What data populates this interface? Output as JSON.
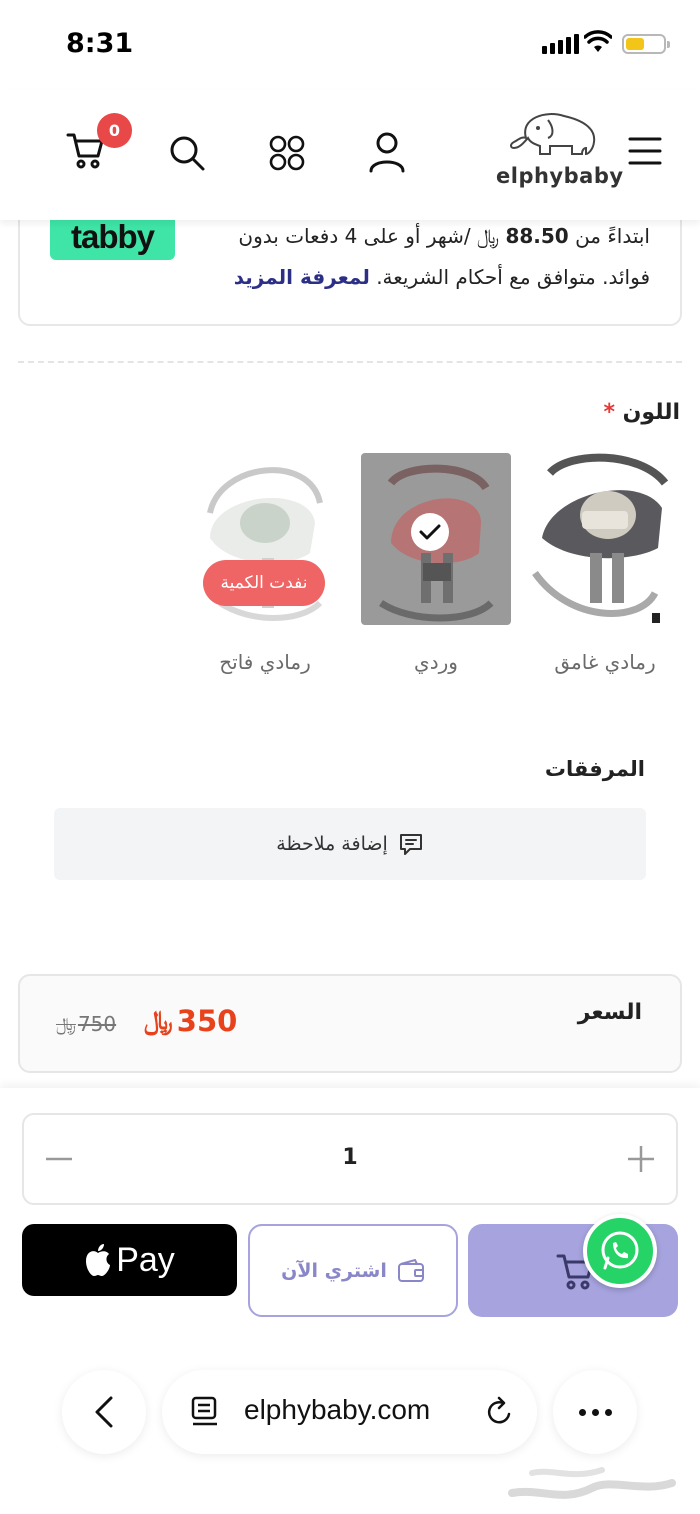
{
  "status_bar": {
    "time": "8:31"
  },
  "header": {
    "cart_count": "0",
    "logo_text": "elphybaby"
  },
  "tabby": {
    "logo": "tabby",
    "line1_prefix": "ابتداءً من ",
    "amount": "88.50",
    "line1_suffix": " /شهر أو على 4 دفعات بدون",
    "line2": "فوائد. متوافق مع أحكام الشريعة. ",
    "learn_more": "لمعرفة المزيد"
  },
  "color_section": {
    "label": "اللون",
    "required_mark": "*",
    "options": [
      {
        "name": "رمادي غامق",
        "selected": false,
        "out_of_stock": false
      },
      {
        "name": "وردي",
        "selected": true,
        "out_of_stock": false
      },
      {
        "name": "رمادي فاتح",
        "selected": false,
        "out_of_stock": true
      }
    ],
    "out_of_stock_label": "نفدت الكمية"
  },
  "attachments": {
    "title": "المرفقات",
    "add_note_label": "إضافة ملاحظة"
  },
  "price": {
    "label": "السعر",
    "current": "350",
    "old": "750",
    "accent_color": "#e8421c"
  },
  "quantity": {
    "value": "1"
  },
  "actions": {
    "apple_pay_label": "Pay",
    "buy_now_label": "اشتري الآن"
  },
  "browser": {
    "url": "elphybaby.com"
  }
}
